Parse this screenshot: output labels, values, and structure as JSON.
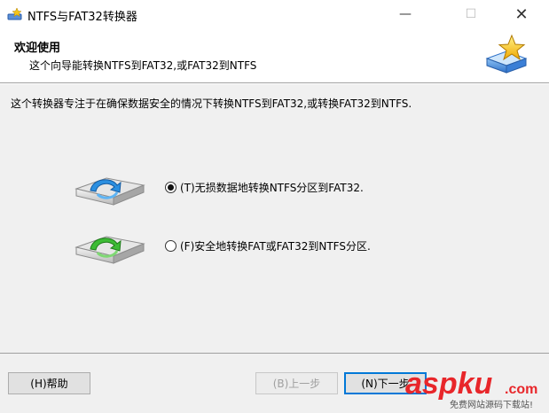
{
  "window": {
    "title": "NTFS与FAT32转换器",
    "minimize_glyph": "—",
    "maximize_glyph": "☐",
    "close_glyph": "✕"
  },
  "header": {
    "title": "欢迎使用",
    "subtitle": "这个向导能转换NTFS到FAT32,或FAT32到NTFS"
  },
  "intro": "这个转换器专注于在确保数据安全的情况下转换NTFS到FAT32,或转换FAT32到NTFS.",
  "options": [
    {
      "label": "(T)无损数据地转换NTFS分区到FAT32.",
      "checked": true,
      "icon": "drive-blue-arrow-icon"
    },
    {
      "label": "(F)安全地转换FAT或FAT32到NTFS分区.",
      "checked": false,
      "icon": "drive-green-arrow-icon"
    }
  ],
  "buttons": {
    "help": "(H)帮助",
    "prev": "(B)上一步",
    "next": "(N)下一步"
  },
  "watermark": {
    "brand": "aspku",
    "suffix": ".com",
    "tagline": "免费网站源码下载站!"
  },
  "colors": {
    "accent": "#0078d7",
    "body_bg": "#f0f0f0",
    "watermark_red": "#e8262a"
  }
}
